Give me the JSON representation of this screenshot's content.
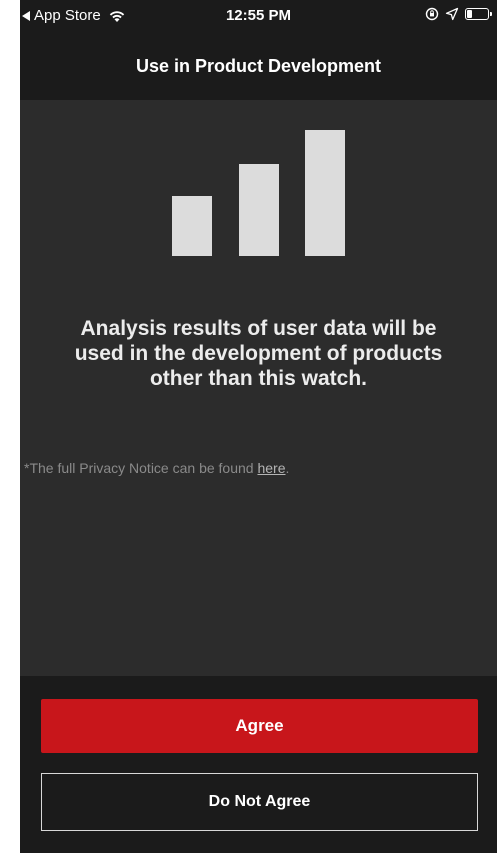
{
  "status_bar": {
    "back_app": "App Store",
    "time": "12:55 PM",
    "battery_level": 0.25
  },
  "nav": {
    "title": "Use in Product Development"
  },
  "content": {
    "message": "Analysis results of user data will be used in the development of products other than this watch.",
    "privacy_prefix": "*The full Privacy Notice can be found ",
    "privacy_link": "here",
    "privacy_suffix": "."
  },
  "graphic": {
    "bar_levels": [
      0.48,
      0.73,
      1.0
    ],
    "bar_color": "#dcdcdc"
  },
  "buttons": {
    "agree": "Agree",
    "disagree": "Do Not Agree"
  },
  "colors": {
    "accent": "#c8161b",
    "background": "#1b1b1b",
    "content_bg": "#2c2c2c"
  }
}
